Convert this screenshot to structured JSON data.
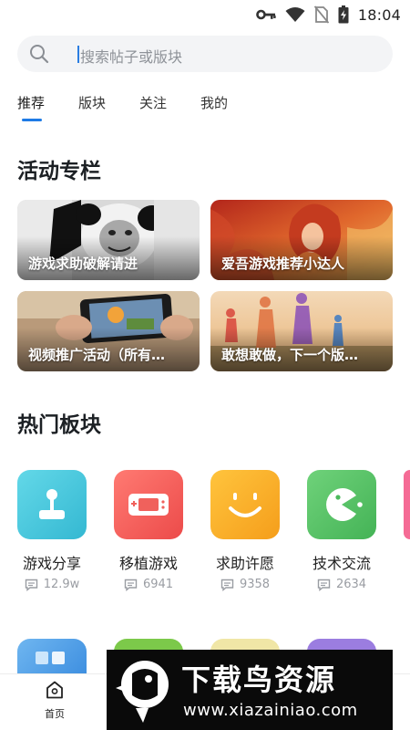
{
  "status_bar": {
    "time": "18:04"
  },
  "search": {
    "placeholder": "搜索帖子或版块"
  },
  "tabs": [
    {
      "label": "推荐"
    },
    {
      "label": "版块"
    },
    {
      "label": "关注"
    },
    {
      "label": "我的"
    }
  ],
  "activity": {
    "title": "活动专栏",
    "cards": [
      {
        "label": "游戏求助破解请进"
      },
      {
        "label": "爱吾游戏推荐小达人"
      },
      {
        "label": "视频推广活动（所有…"
      },
      {
        "label": "敢想敢做，下一个版…"
      }
    ]
  },
  "hot": {
    "title": "热门板块",
    "boards": [
      {
        "name": "游戏分享",
        "count": "12.9w",
        "color": "#3fc6d9"
      },
      {
        "name": "移植游戏",
        "count": "6941",
        "color": "#f05b56"
      },
      {
        "name": "求助许愿",
        "count": "9358",
        "color": "#f7a823"
      },
      {
        "name": "技术交流",
        "count": "2634",
        "color": "#58c161"
      }
    ]
  },
  "bottom_nav": {
    "home_label": "首页"
  },
  "watermark": {
    "title": "下载鸟资源",
    "url": "www.xiazainiao.com"
  }
}
